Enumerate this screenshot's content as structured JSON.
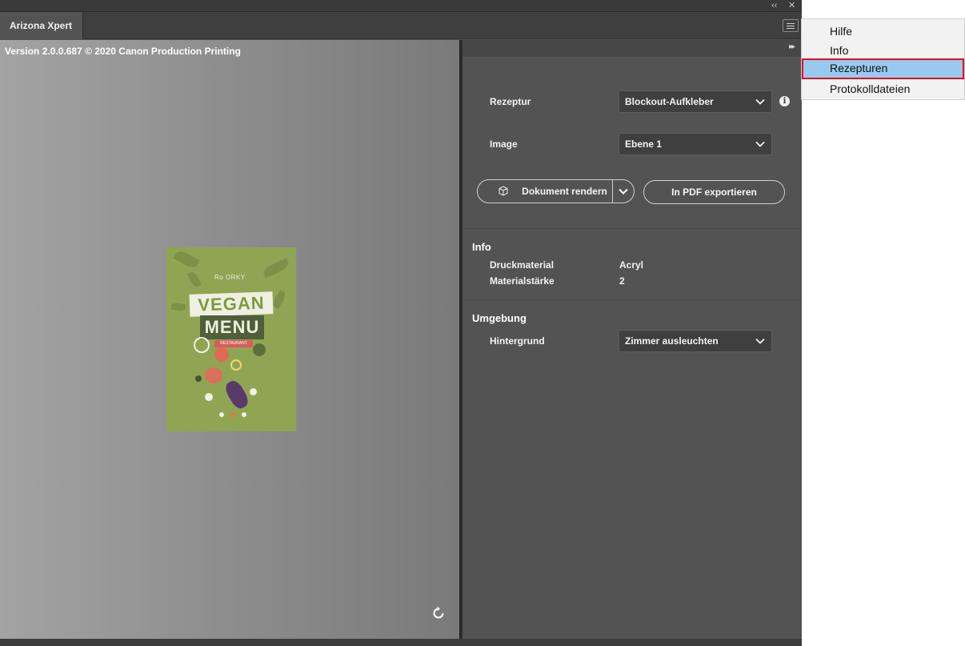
{
  "window": {
    "collapse_label": "‹‹",
    "close_label": "✕",
    "tab_title": "Arizona Xpert"
  },
  "preview": {
    "version_text": "Version 2.0.0.687 © 2020 Canon Production Printing",
    "poster": {
      "small_text": "Ro ORKY",
      "title_line1": "VEGAN",
      "title_line2": "MENU",
      "tag": "RESTAURANT"
    }
  },
  "settings": {
    "collapse_label": "▸▸",
    "rezeptur": {
      "label": "Rezeptur",
      "value": "Blockout-Aufkleber"
    },
    "image": {
      "label": "Image",
      "value": "Ebene 1"
    },
    "render_button": "Dokument rendern",
    "export_button": "In PDF exportieren",
    "info": {
      "title": "Info",
      "rows": [
        {
          "label": "Druckmaterial",
          "value": "Acryl"
        },
        {
          "label": "Materialstärke",
          "value": "2"
        }
      ]
    },
    "environment": {
      "title": "Umgebung",
      "background_label": "Hintergrund",
      "background_value": "Zimmer ausleuchten"
    }
  },
  "flyout_menu": {
    "items": [
      {
        "label": "Hilfe"
      },
      {
        "label": "Info"
      },
      {
        "label": "Rezepturen"
      },
      {
        "label": "Protokolldateien"
      }
    ],
    "active_index": 2
  },
  "colors": {
    "panel_bg": "#535353",
    "menu_highlight": "#99c9ef",
    "menu_highlight_border": "#e0101e",
    "poster_green": "#8fa554"
  }
}
